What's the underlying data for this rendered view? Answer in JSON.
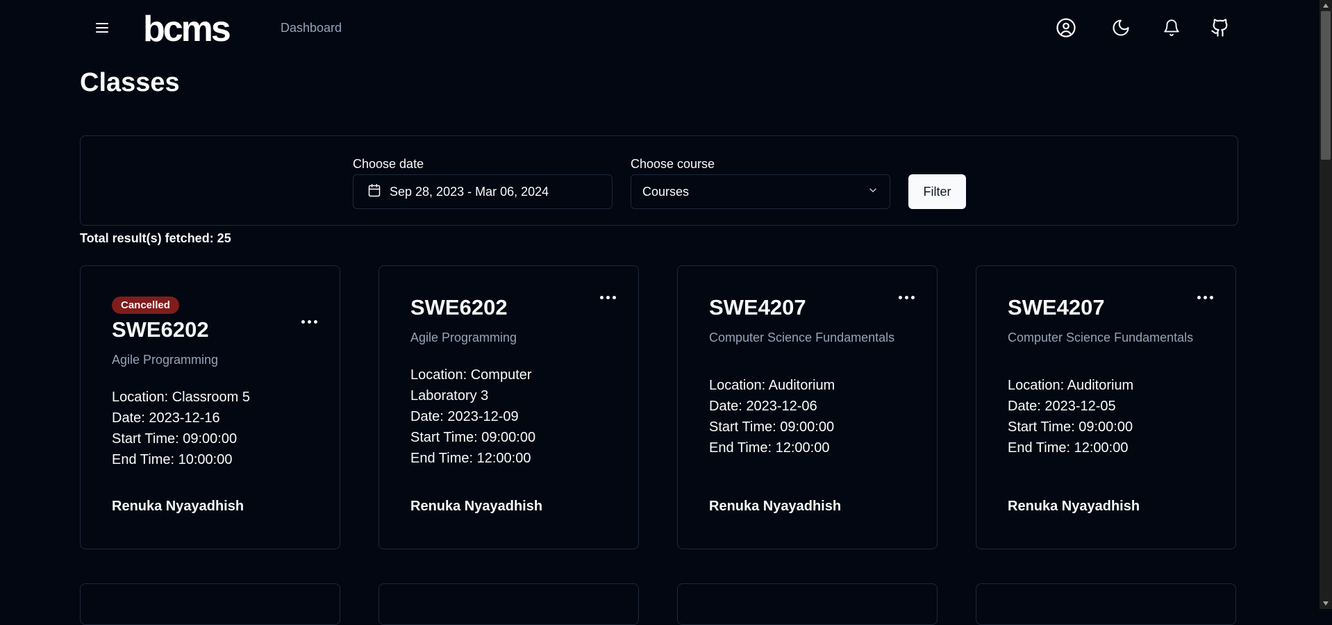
{
  "header": {
    "logo_text": "bcms",
    "nav_link": "Dashboard",
    "icons": [
      "menu-icon",
      "user-circle-icon",
      "moon-icon",
      "bell-icon",
      "github-icon"
    ]
  },
  "page": {
    "title": "Classes"
  },
  "filters": {
    "date_label": "Choose date",
    "date_value": "Sep 28, 2023 - Mar 06, 2024",
    "course_label": "Choose course",
    "course_value": "Courses",
    "filter_button": "Filter"
  },
  "results": {
    "total_text": "Total result(s) fetched: 25"
  },
  "classes": [
    {
      "badge": "Cancelled",
      "code": "SWE6202",
      "course": "Agile Programming",
      "location": "Location: Classroom 5",
      "date": "Date: 2023-12-16",
      "start": "Start Time: 09:00:00",
      "end": "End Time: 10:00:00",
      "instructor": "Renuka Nyayadhish"
    },
    {
      "code": "SWE6202",
      "course": "Agile Programming",
      "location": "Location: Computer Laboratory 3",
      "date": "Date: 2023-12-09",
      "start": "Start Time: 09:00:00",
      "end": "End Time: 12:00:00",
      "instructor": "Renuka Nyayadhish"
    },
    {
      "code": "SWE4207",
      "course": "Computer Science Fundamentals",
      "location": "Location: Auditorium",
      "date": "Date: 2023-12-06",
      "start": "Start Time: 09:00:00",
      "end": "End Time: 12:00:00",
      "instructor": "Renuka Nyayadhish"
    },
    {
      "code": "SWE4207",
      "course": "Computer Science Fundamentals",
      "location": "Location: Auditorium",
      "date": "Date: 2023-12-05",
      "start": "Start Time: 09:00:00",
      "end": "End Time: 12:00:00",
      "instructor": "Renuka Nyayadhish"
    }
  ],
  "colors": {
    "background": "#030711",
    "border": "#1e293b",
    "muted_text": "#94a3b8",
    "badge_bg": "#7f1d1d"
  }
}
